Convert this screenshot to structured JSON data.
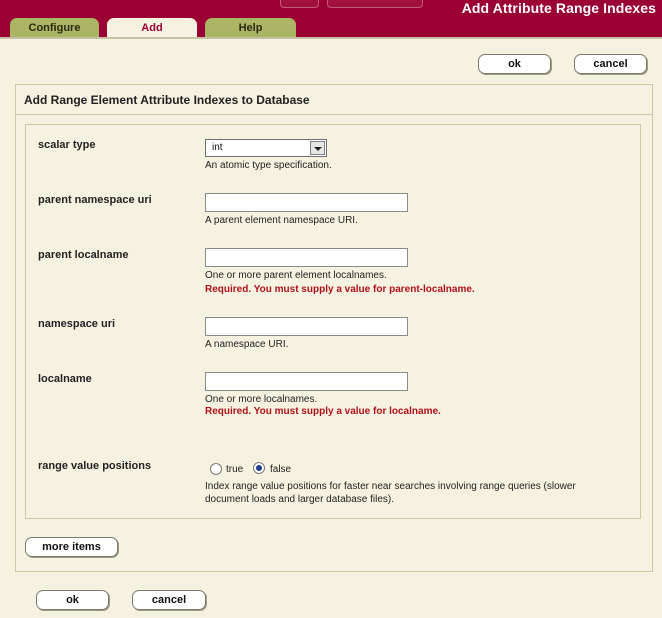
{
  "header": {
    "title": "Add Attribute Range Indexes",
    "tabs": [
      {
        "label": "Configure",
        "active": false
      },
      {
        "label": "Add",
        "active": true
      },
      {
        "label": "Help",
        "active": false
      }
    ]
  },
  "top_actions": {
    "ok_label": "ok",
    "cancel_label": "cancel"
  },
  "form": {
    "title": "Add Range Element Attribute Indexes to Database",
    "fields": {
      "scalar_type": {
        "label": "scalar type",
        "value": "int",
        "help": "An atomic type specification."
      },
      "parent_namespace_uri": {
        "label": "parent namespace uri",
        "value": "",
        "help": "A parent element namespace URI."
      },
      "parent_localname": {
        "label": "parent localname",
        "value": "",
        "help": "One or more parent element localnames.",
        "error": "Required. You must supply a value for parent-localname."
      },
      "namespace_uri": {
        "label": "namespace uri",
        "value": "",
        "help": "A namespace URI."
      },
      "localname": {
        "label": "localname",
        "value": "",
        "help": "One or more localnames.",
        "error": "Required. You must supply a value for localname."
      },
      "range_value_positions": {
        "label": "range value positions",
        "options": [
          "true",
          "false"
        ],
        "selected": "false",
        "help_line1": "Index range value positions for faster near searches involving range queries (slower",
        "help_line2": "document loads and larger database files)."
      }
    },
    "more_items_label": "more items"
  },
  "bottom_actions": {
    "ok_label": "ok",
    "cancel_label": "cancel"
  },
  "colors": {
    "brand": "#9a0034",
    "tab": "#aab664",
    "background": "#f5f2e1",
    "error": "#b0101a"
  }
}
